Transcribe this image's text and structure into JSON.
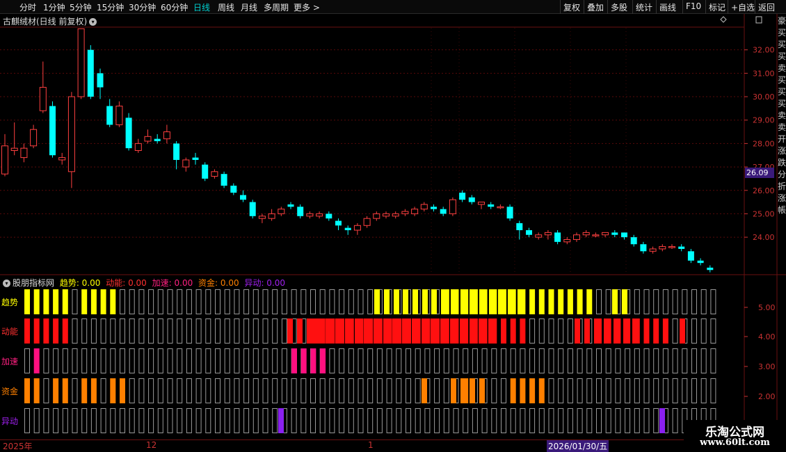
{
  "toolbar": {
    "timeframes": [
      "分时",
      "1分钟",
      "5分钟",
      "15分钟",
      "30分钟",
      "60分钟",
      "日线",
      "周线",
      "月线",
      "多周期",
      "更多 >"
    ],
    "active": "日线",
    "right_buttons": [
      "复权",
      "叠加",
      "多股",
      "统计",
      "画线",
      "F10",
      "标记",
      "+自选",
      "返回"
    ]
  },
  "main": {
    "title": "古麒绒材(日线 前复权)",
    "current_price": "26.09",
    "y_ticks": [
      "32.00",
      "31.00",
      "30.00",
      "29.00",
      "28.00",
      "27.00",
      "26.00",
      "25.00",
      "24.00"
    ]
  },
  "indicator": {
    "name": "股朋指标网",
    "values": [
      {
        "label": "趋势: 0.00",
        "color": "#ffff00"
      },
      {
        "label": "动能: 0.00",
        "color": "#ff3030"
      },
      {
        "label": "加速: 0.00",
        "color": "#ff2080"
      },
      {
        "label": "资金: 0.00",
        "color": "#ff8000"
      },
      {
        "label": "异动: 0.00",
        "color": "#a020f0"
      }
    ],
    "rows": [
      {
        "name": "趋势",
        "color": "#ffff00",
        "label_color": "#ffff00"
      },
      {
        "name": "动能",
        "color": "#ff1010",
        "label_color": "#ff3030"
      },
      {
        "name": "加速",
        "color": "#ff1080",
        "label_color": "#ff2080"
      },
      {
        "name": "资金",
        "color": "#ff8000",
        "label_color": "#ff8000"
      },
      {
        "name": "异动",
        "color": "#8a20f0",
        "label_color": "#a020f0"
      }
    ],
    "y_ticks": [
      "5.00",
      "4.00",
      "3.00",
      "2.00",
      "1.00"
    ]
  },
  "bottom": {
    "labels": [
      "2025年",
      "12",
      "1"
    ],
    "date_badge": "2026/01/30/五"
  },
  "watermark": {
    "line1": "乐淘公式网",
    "line2": "www.60lt.com"
  },
  "chart_data": {
    "type": "candlestick",
    "candles": [
      [
        26.7,
        27.9,
        26.6,
        28.4
      ],
      [
        27.7,
        27.8,
        27.5,
        28.9
      ],
      [
        27.4,
        27.8,
        27.2,
        28.0
      ],
      [
        27.9,
        28.6,
        27.8,
        28.8
      ],
      [
        29.4,
        30.4,
        29.3,
        31.5
      ],
      [
        29.6,
        27.5,
        27.4,
        29.8
      ],
      [
        27.3,
        27.4,
        27.1,
        27.6
      ],
      [
        26.8,
        30.0,
        26.1,
        30.2
      ],
      [
        30.0,
        32.9,
        29.9,
        32.9
      ],
      [
        32.0,
        30.0,
        29.9,
        32.2
      ],
      [
        31.0,
        30.4,
        29.9,
        31.2
      ],
      [
        29.6,
        28.8,
        28.7,
        29.9
      ],
      [
        28.8,
        29.6,
        28.7,
        29.8
      ],
      [
        29.1,
        27.8,
        27.7,
        29.3
      ],
      [
        27.7,
        28.0,
        27.6,
        28.2
      ],
      [
        28.1,
        28.3,
        28.0,
        28.6
      ],
      [
        28.2,
        28.1,
        28.0,
        28.4
      ],
      [
        28.2,
        28.5,
        28.0,
        28.8
      ],
      [
        28.0,
        27.3,
        26.9,
        28.1
      ],
      [
        27.0,
        27.3,
        26.8,
        27.4
      ],
      [
        27.4,
        27.3,
        27.1,
        27.6
      ],
      [
        27.1,
        26.5,
        26.4,
        27.2
      ],
      [
        26.6,
        26.8,
        26.5,
        26.9
      ],
      [
        26.7,
        26.2,
        26.1,
        26.8
      ],
      [
        26.2,
        25.9,
        25.8,
        26.3
      ],
      [
        25.8,
        25.6,
        25.5,
        26.0
      ],
      [
        25.5,
        24.9,
        24.8,
        25.6
      ],
      [
        24.8,
        24.9,
        24.6,
        25.0
      ],
      [
        24.8,
        25.0,
        24.7,
        25.2
      ],
      [
        25.0,
        25.2,
        24.9,
        25.3
      ],
      [
        25.4,
        25.3,
        25.2,
        25.5
      ],
      [
        25.3,
        24.9,
        24.8,
        25.4
      ],
      [
        24.9,
        25.0,
        24.8,
        25.1
      ],
      [
        24.9,
        25.0,
        24.8,
        25.1
      ],
      [
        25.0,
        24.8,
        24.7,
        25.1
      ],
      [
        24.7,
        24.5,
        24.3,
        24.8
      ],
      [
        24.4,
        24.3,
        24.1,
        24.5
      ],
      [
        24.3,
        24.5,
        24.1,
        24.6
      ],
      [
        24.5,
        24.8,
        24.4,
        24.9
      ],
      [
        24.8,
        25.0,
        24.7,
        25.1
      ],
      [
        24.9,
        25.0,
        24.8,
        25.1
      ],
      [
        24.9,
        25.0,
        24.8,
        25.1
      ],
      [
        25.0,
        25.1,
        24.9,
        25.2
      ],
      [
        25.0,
        25.2,
        24.9,
        25.3
      ],
      [
        25.2,
        25.4,
        25.1,
        25.5
      ],
      [
        25.3,
        25.2,
        25.1,
        25.4
      ],
      [
        25.2,
        25.0,
        24.9,
        25.3
      ],
      [
        25.0,
        25.6,
        24.9,
        25.7
      ],
      [
        25.9,
        25.6,
        25.5,
        26.0
      ],
      [
        25.7,
        25.5,
        25.4,
        25.8
      ],
      [
        25.4,
        25.5,
        25.2,
        25.5
      ],
      [
        25.4,
        25.3,
        25.2,
        25.5
      ],
      [
        25.3,
        25.3,
        25.2,
        25.4
      ],
      [
        25.3,
        24.8,
        24.7,
        25.4
      ],
      [
        24.6,
        24.3,
        23.9,
        24.7
      ],
      [
        24.3,
        24.1,
        24.0,
        24.4
      ],
      [
        24.0,
        24.1,
        23.9,
        24.2
      ],
      [
        24.1,
        24.2,
        23.9,
        24.3
      ],
      [
        24.2,
        23.8,
        23.7,
        24.3
      ],
      [
        23.8,
        23.9,
        23.7,
        24.0
      ],
      [
        23.9,
        24.1,
        23.8,
        24.2
      ],
      [
        24.1,
        24.2,
        24.0,
        24.3
      ],
      [
        24.1,
        24.1,
        24.0,
        24.2
      ],
      [
        24.1,
        24.2,
        24.0,
        24.2
      ],
      [
        24.2,
        24.1,
        24.0,
        24.3
      ],
      [
        24.2,
        24.0,
        23.9,
        24.2
      ],
      [
        24.0,
        23.7,
        23.6,
        24.1
      ],
      [
        23.7,
        23.4,
        23.3,
        23.8
      ],
      [
        23.4,
        23.5,
        23.3,
        23.6
      ],
      [
        23.5,
        23.6,
        23.4,
        23.7
      ],
      [
        23.6,
        23.6,
        23.5,
        23.7
      ],
      [
        23.6,
        23.5,
        23.4,
        23.7
      ],
      [
        23.4,
        23.0,
        22.9,
        23.5
      ],
      [
        23.0,
        22.9,
        22.8,
        23.1
      ],
      [
        22.7,
        22.6,
        22.5,
        22.8
      ]
    ],
    "signals": {
      "趋势": "11111011110000000000000000000000000000000000111111111111111100000000000000000110000000",
      "动能": "11111000000000000000000000000011111111111111111111111000000011111111000000000010000",
      "加速": "01000000000000000000000000000000000000000000000000000000000000000000000000000000000",
      "资金": "11011011011000000000000000000000000000000000001000011110000000000000000000000000000",
      "异动": "00000000000000000000000000000000000000000000000000000000000000000000000000000000000"
    },
    "ylim": [
      22.4,
      33.0
    ]
  }
}
